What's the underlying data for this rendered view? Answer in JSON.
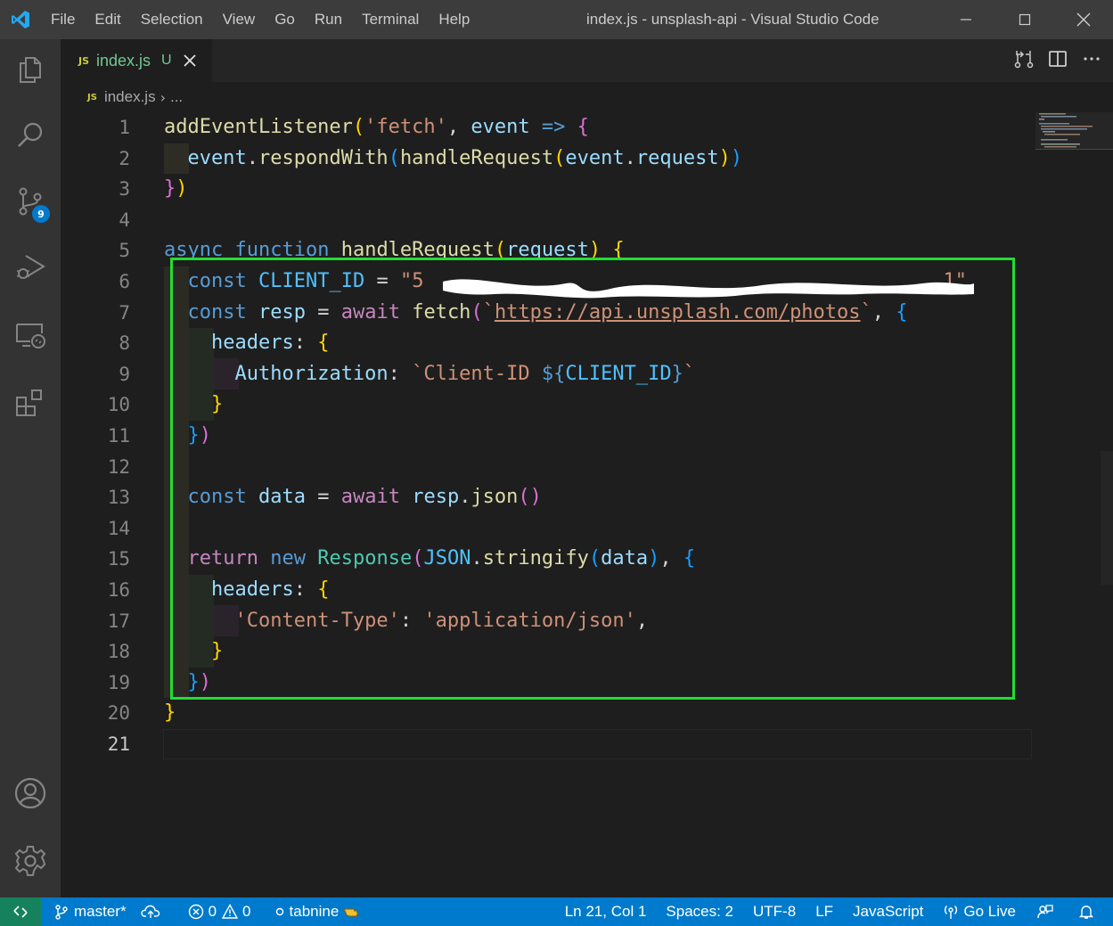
{
  "titlebar": {
    "menu": [
      "File",
      "Edit",
      "Selection",
      "View",
      "Go",
      "Run",
      "Terminal",
      "Help"
    ],
    "window_title": "index.js - unsplash-api - Visual Studio Code"
  },
  "activitybar": {
    "source_control_badge": "9"
  },
  "tab": {
    "icon_text": "JS",
    "name": "index.js",
    "status": "U"
  },
  "breadcrumb": {
    "icon_text": "JS",
    "file": "index.js",
    "more": "..."
  },
  "editor": {
    "line_numbers": [
      "1",
      "2",
      "3",
      "4",
      "5",
      "6",
      "7",
      "8",
      "9",
      "10",
      "11",
      "12",
      "13",
      "14",
      "15",
      "16",
      "17",
      "18",
      "19",
      "20",
      "21"
    ],
    "active_line": "21",
    "client_id_prefix": "\"5",
    "client_id_suffix": "1\""
  },
  "statusbar": {
    "branch": "master*",
    "errors": "0",
    "warnings": "0",
    "tabnine": "tabnine",
    "cursor": "Ln 21, Col 1",
    "spaces": "Spaces: 2",
    "encoding": "UTF-8",
    "eol": "LF",
    "language": "JavaScript",
    "go_live": "Go Live"
  },
  "colors": {
    "titlebar": "#3c3c3c",
    "activitybar": "#333333",
    "editor": "#1e1e1e",
    "statusbar": "#007acc",
    "remote": "#16825d",
    "highlight_box": "#22dd33"
  }
}
